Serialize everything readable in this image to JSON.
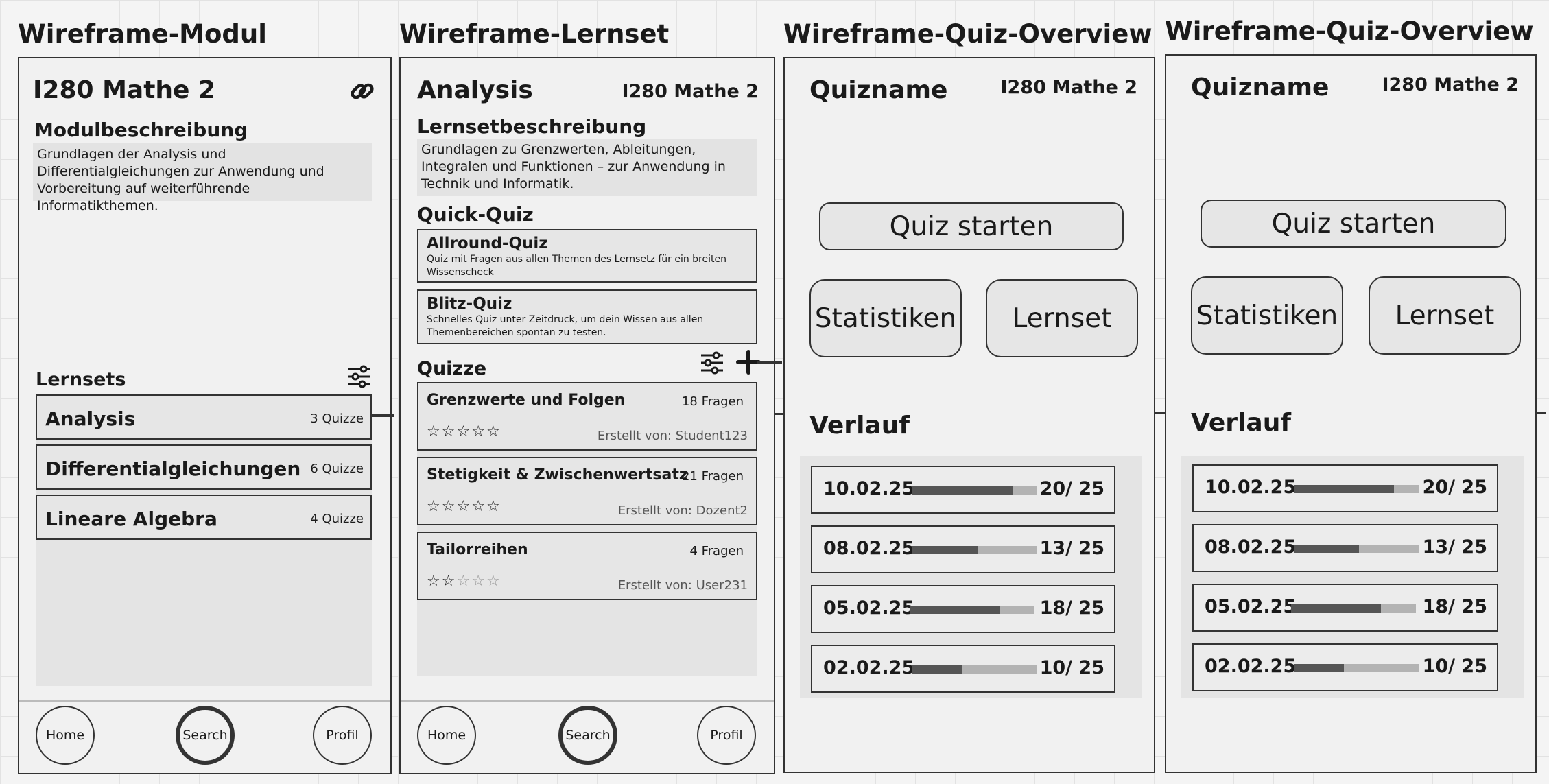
{
  "screens": {
    "modul": {
      "wireframe_title": "Wireframe-Modul",
      "module_name": "I280 Mathe 2",
      "link_icon": "link-icon",
      "description_heading": "Modulbeschreibung",
      "description": "Grundlagen der Analysis und Differentialgleichungen zur Anwendung und Vorbereitung auf weiterführende Informatikthemen.",
      "lernsets_heading": "Lernsets",
      "filter_icon": "sliders-icon",
      "lernsets": [
        {
          "name": "Analysis",
          "count": "3 Quizze"
        },
        {
          "name": "Differentialgleichungen",
          "count": "6 Quizze"
        },
        {
          "name": "Lineare Algebra",
          "count": "4 Quizze"
        }
      ],
      "nav": {
        "home": "Home",
        "search": "Search",
        "profil": "Profil"
      }
    },
    "lernset": {
      "wireframe_title": "Wireframe-Lernset",
      "title": "Analysis",
      "module_tag": "I280 Mathe 2",
      "description_heading": "Lernsetbeschreibung",
      "description": "Grundlagen zu Grenzwerten, Ableitungen, Integralen und Funktionen – zur Anwendung in Technik und Informatik.",
      "quick_quiz_heading": "Quick-Quiz",
      "quick_quizzes": [
        {
          "name": "Allround-Quiz",
          "desc": "Quiz mit Fragen aus allen Themen des Lernsetz für ein breiten Wissenscheck"
        },
        {
          "name": "Blitz-Quiz",
          "desc": "Schnelles Quiz unter Zeitdruck, um dein Wissen aus allen Themenbereichen spontan zu testen."
        }
      ],
      "quizze_heading": "Quizze",
      "filter_icon": "sliders-icon",
      "add_icon": "plus-icon",
      "quizze": [
        {
          "name": "Grenzwerte und Folgen",
          "questions": "18 Fragen",
          "rating": 0,
          "max_rating": 5,
          "author": "Erstellt von: Student123"
        },
        {
          "name": "Stetigkeit & Zwischenwertsatz",
          "questions": "21 Fragen",
          "rating": 0,
          "max_rating": 5,
          "author": "Erstellt von: Dozent2"
        },
        {
          "name": "Tailorreihen",
          "questions": "4 Fragen",
          "rating": 2,
          "max_rating": 5,
          "author": "Erstellt von: User231"
        }
      ],
      "nav": {
        "home": "Home",
        "search": "Search",
        "profil": "Profil"
      }
    },
    "overview": {
      "wireframe_title": "Wireframe-Quiz-Overview",
      "quiz_name": "Quizname",
      "module_tag": "I280 Mathe 2",
      "start_label": "Quiz starten",
      "stats_label": "Statistiken",
      "lernset_label": "Lernset",
      "history_heading": "Verlauf",
      "history": [
        {
          "date": "10.02.25",
          "score": "20/ 25",
          "progress": 0.8
        },
        {
          "date": "08.02.25",
          "score": "13/ 25",
          "progress": 0.52
        },
        {
          "date": "05.02.25",
          "score": "18/ 25",
          "progress": 0.72
        },
        {
          "date": "02.02.25",
          "score": "10/ 25",
          "progress": 0.4
        }
      ]
    }
  }
}
